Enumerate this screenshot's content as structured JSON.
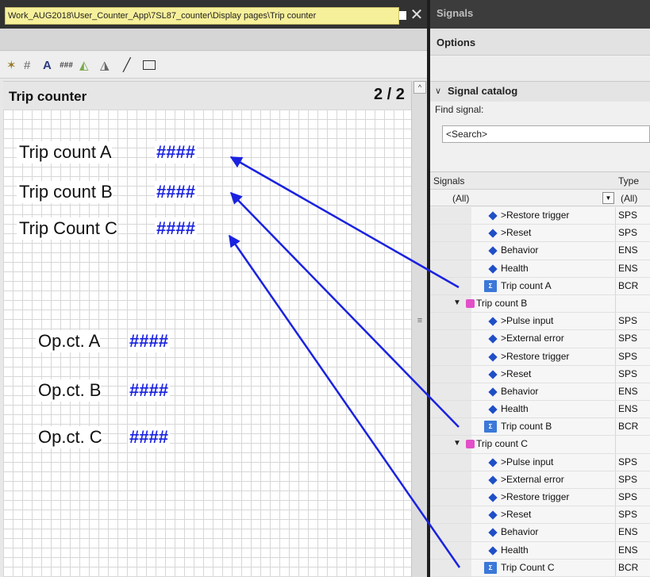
{
  "editor": {
    "tab_title": "Work_AUG2018\\User_Counter_App\\7SL87_counter\\Display pages\\Trip counter",
    "tab_close": "✕",
    "toolbar": {
      "icons": [
        "wand-icon",
        "grid-icon",
        "text-icon",
        "hash-field-icon",
        "triangle-tool-icon",
        "triangle-tool-2-icon",
        "line-icon",
        "rectangle-icon"
      ],
      "text_glyph": "A",
      "hash_glyph": "###",
      "line_glyph": "╱"
    },
    "page_title": "Trip counter",
    "page_number": "2 / 2",
    "scroll_up": "^",
    "scroll_grip": "≡",
    "fields": [
      {
        "label": "Trip count A",
        "value": "####"
      },
      {
        "label": "Trip count B",
        "value": "####"
      },
      {
        "label": "Trip Count C",
        "value": "####"
      },
      {
        "label": "Op.ct. A",
        "value": "####"
      },
      {
        "label": "Op.ct. B",
        "value": "####"
      },
      {
        "label": "Op.ct. C",
        "value": "####"
      }
    ],
    "arrow_color": "#1a22e0"
  },
  "signals_panel": {
    "title": "Signals",
    "options_label": "Options",
    "catalog": {
      "chevron": "∨",
      "label": "Signal catalog",
      "find_label": "Find signal:",
      "search_placeholder": "<Search>"
    },
    "grid": {
      "col_signals": "Signals",
      "col_type": "Type",
      "filter_value": "(All)",
      "filter_type": "(All)",
      "filter_dropdown_icon": "▼"
    },
    "rows": [
      {
        "kind": "signal",
        "name": ">Restore trigger",
        "type": "SPS"
      },
      {
        "kind": "signal",
        "name": ">Reset",
        "type": "SPS"
      },
      {
        "kind": "signal",
        "name": "Behavior",
        "type": "ENS"
      },
      {
        "kind": "signal",
        "name": "Health",
        "type": "ENS"
      },
      {
        "kind": "counter",
        "name": "Trip count A",
        "type": "BCR"
      },
      {
        "kind": "group",
        "name": "Trip count B",
        "type": ""
      },
      {
        "kind": "signal",
        "name": ">Pulse input",
        "type": "SPS"
      },
      {
        "kind": "signal",
        "name": ">External error",
        "type": "SPS"
      },
      {
        "kind": "signal",
        "name": ">Restore trigger",
        "type": "SPS"
      },
      {
        "kind": "signal",
        "name": ">Reset",
        "type": "SPS"
      },
      {
        "kind": "signal",
        "name": "Behavior",
        "type": "ENS"
      },
      {
        "kind": "signal",
        "name": "Health",
        "type": "ENS"
      },
      {
        "kind": "counter",
        "name": "Trip count B",
        "type": "BCR"
      },
      {
        "kind": "group",
        "name": "Trip count C",
        "type": ""
      },
      {
        "kind": "signal",
        "name": ">Pulse input",
        "type": "SPS"
      },
      {
        "kind": "signal",
        "name": ">External error",
        "type": "SPS"
      },
      {
        "kind": "signal",
        "name": ">Restore trigger",
        "type": "SPS"
      },
      {
        "kind": "signal",
        "name": ">Reset",
        "type": "SPS"
      },
      {
        "kind": "signal",
        "name": "Behavior",
        "type": "ENS"
      },
      {
        "kind": "signal",
        "name": "Health",
        "type": "ENS"
      },
      {
        "kind": "counter",
        "name": "Trip Count C",
        "type": "BCR"
      }
    ],
    "counter_icon_text": "Σ",
    "group_expand_icon": "▼"
  }
}
